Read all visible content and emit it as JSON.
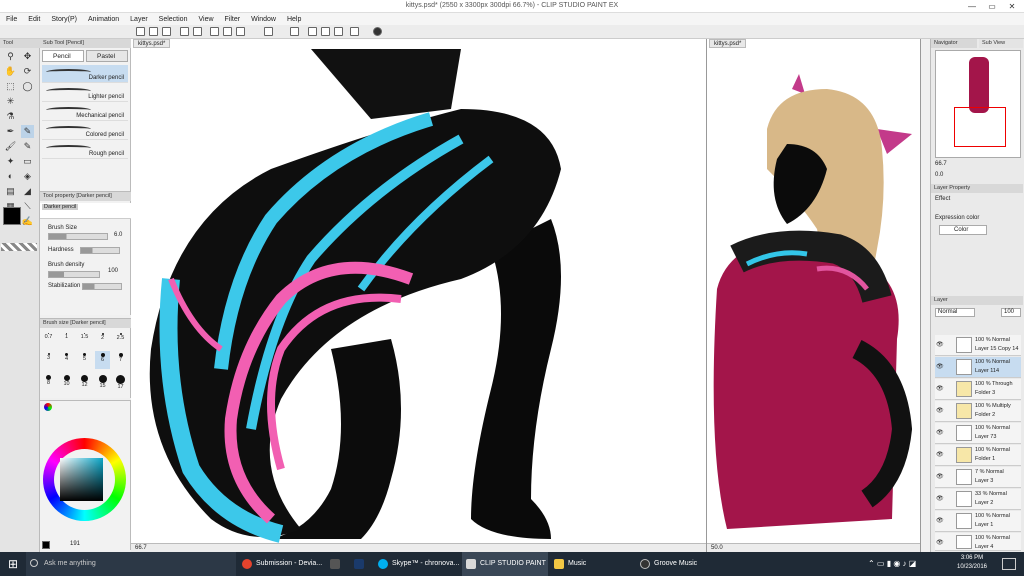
{
  "titlebar": {
    "title": "kittys.psd* (2550 x 3300px 300dpi 66.7%) - CLIP STUDIO PAINT EX"
  },
  "menu": [
    "File",
    "Edit",
    "Story(P)",
    "Animation",
    "Layer",
    "Selection",
    "View",
    "Filter",
    "Window",
    "Help"
  ],
  "tool_palette": {
    "tab": "Tool"
  },
  "subtool": {
    "tab": "Sub Tool [Pencil]",
    "tabs": [
      "Pencil",
      "Pastel"
    ],
    "brushes": [
      "Darker pencil",
      "Lighter pencil",
      "Mechanical pencil",
      "Colored pencil",
      "Rough pencil"
    ]
  },
  "tool_property": {
    "tab": "Tool property [Darker pencil]",
    "preview_name": "Darker pencil",
    "brush_size_label": "Brush Size",
    "brush_size_value": "6.0",
    "hardness_label": "Hardness",
    "density_label": "Brush density",
    "density_value": "100",
    "stabilization_label": "Stabilization"
  },
  "brush_size": {
    "tab": "Brush size [Darker pencil]",
    "values": [
      "0.7",
      "1",
      "1.5",
      "2",
      "2.5",
      "3",
      "4",
      "5",
      "6",
      "7",
      "8",
      "10",
      "12",
      "15",
      "17"
    ]
  },
  "color": {
    "main_color": "#000000",
    "sub_color": "#ffffff",
    "counter": "191"
  },
  "canvas1": {
    "tab": "kittys.psd*",
    "zoom": "66.7"
  },
  "canvas2": {
    "tab": "kittys.psd*",
    "zoom": "50.0"
  },
  "navigator": {
    "tab": "Navigator",
    "tab2": "Sub View",
    "zoom": "66.7",
    "angle": "0.0"
  },
  "layer_property": {
    "tab": "Layer Property",
    "effect_label": "Effect",
    "expression_label": "Expression color",
    "expression_value": "Color"
  },
  "layer_panel": {
    "tab": "Layer",
    "blend_mode": "Normal",
    "opacity": "100",
    "layers": [
      {
        "mode": "100 % Normal",
        "name": "Layer 15 Copy 14"
      },
      {
        "mode": "100 % Normal",
        "name": "Layer 114"
      },
      {
        "mode": "100 % Through",
        "name": "Folder 3"
      },
      {
        "mode": "100 % Multiply",
        "name": "Folder 2"
      },
      {
        "mode": "100 % Normal",
        "name": "Layer 73"
      },
      {
        "mode": "100 % Normal",
        "name": "Folder 1"
      },
      {
        "mode": "7 % Normal",
        "name": "Layer 3"
      },
      {
        "mode": "33 % Normal",
        "name": "Layer 2"
      },
      {
        "mode": "100 % Normal",
        "name": "Layer 1"
      },
      {
        "mode": "100 % Normal",
        "name": "Layer 4"
      }
    ]
  },
  "taskbar": {
    "search": "Ask me anything",
    "apps": [
      "Submission - Devia...",
      "Skype™ - chronova...",
      "CLIP STUDIO PAINT",
      "Music",
      "Groove Music"
    ],
    "time": "3:06 PM",
    "date": "10/23/2016"
  },
  "icon_colors": {
    "chrome": "#e5432d",
    "ps": "#1a3a6b",
    "skype": "#00aff0",
    "csp": "#d9d9d9",
    "music": "#f2c744",
    "groove": "#333333"
  }
}
